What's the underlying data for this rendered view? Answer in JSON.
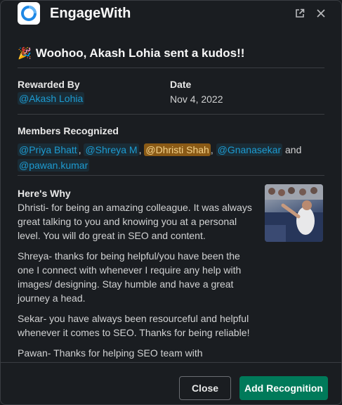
{
  "app": {
    "title": "EngageWith",
    "logo_icon": "engagewith-logo",
    "open_icon": "external-link-icon",
    "close_icon": "close-icon"
  },
  "headline": {
    "emoji": "🎉",
    "text": "Woohoo, Akash Lohia sent a kudos!!"
  },
  "rewarded_by": {
    "label": "Rewarded By",
    "value": "@Akash Lohia"
  },
  "date": {
    "label": "Date",
    "value": "Nov 4, 2022"
  },
  "members": {
    "label": "Members Recognized",
    "mentions": [
      "@Priya Bhatt",
      "@Shreya M",
      "@Dhristi Shah",
      "@Gnanasekar",
      "@pawan.kumar"
    ],
    "separator": ",",
    "conjunction": "and"
  },
  "why": {
    "label": "Here's Why",
    "paragraphs": [
      "Dhristi- for being an amazing colleague. It was always great talking to you and knowing you at a personal level. You will do great in SEO and content.",
      "Shreya- thanks for being helpful/you have been the one I connect with whenever I require any help with images/ designing. Stay humble and have a great journey a head.",
      "Sekar- you have always been resourceful and helpful whenever it comes to SEO. Thanks for being reliable!",
      "Pawan- Thanks for helping SEO team with outreaching"
    ]
  },
  "buttons": {
    "close": "Close",
    "add": "Add Recognition"
  },
  "colors": {
    "background": "#1a1d21",
    "mention": "#1d9bd1",
    "mention_highlight_bg": "#8a5a16",
    "primary_button": "#007a5a"
  }
}
